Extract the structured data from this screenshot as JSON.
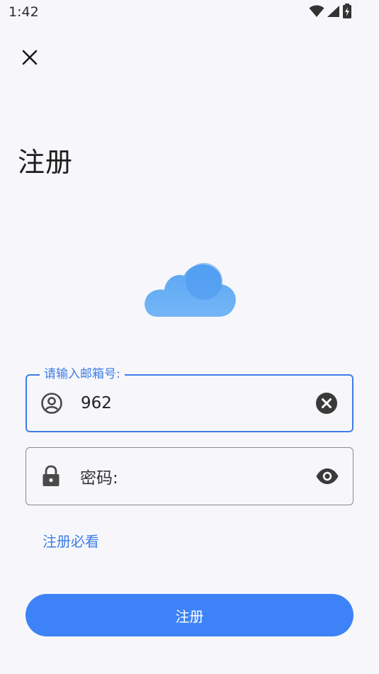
{
  "status_bar": {
    "time": "1:42"
  },
  "icons": {
    "close": "close-icon",
    "wifi": "wifi-icon",
    "signal": "signal-icon",
    "battery": "battery-charging-icon",
    "user": "account-circle-icon",
    "clear": "clear-circle-icon",
    "lock": "lock-icon",
    "visibility": "eye-icon",
    "logo": "cloud-icon"
  },
  "header": {
    "title": "注册"
  },
  "form": {
    "email": {
      "label": "请输入邮箱号:",
      "value": "962"
    },
    "password": {
      "placeholder": "密码:"
    },
    "must_read_link": "注册必看",
    "submit_label": "注册"
  },
  "colors": {
    "accent": "#3d7de6",
    "button": "#3d83f7",
    "background": "#f7f7fb",
    "cloud_light": "#6bb0f5",
    "cloud_dark": "#4b98ef"
  }
}
